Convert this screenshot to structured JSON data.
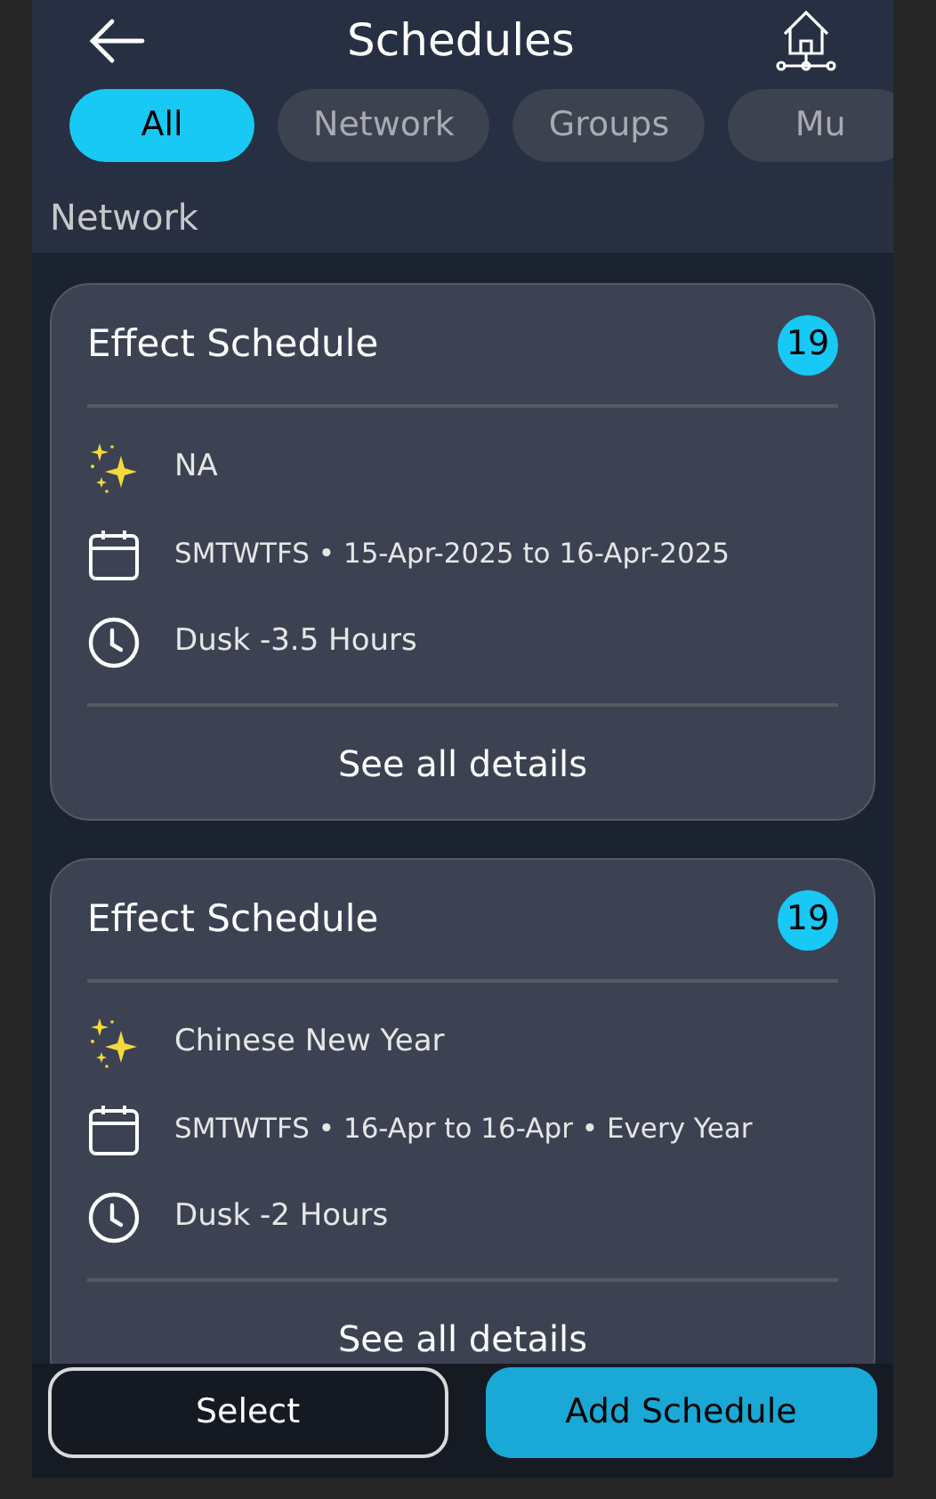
{
  "header": {
    "title": "Schedules"
  },
  "tabs": [
    {
      "label": "All",
      "selected": true
    },
    {
      "label": "Network",
      "selected": false
    },
    {
      "label": "Groups",
      "selected": false
    },
    {
      "label": "Mu",
      "selected": false
    }
  ],
  "section": {
    "title": "Network"
  },
  "cards": [
    {
      "title": "Effect Schedule",
      "count": "19",
      "effect": "NA",
      "dates": "SMTWTFS • 15-Apr-2025 to 16-Apr-2025",
      "time": "Dusk -3.5 Hours",
      "link": "See all details"
    },
    {
      "title": "Effect Schedule",
      "count": "19",
      "effect": "Chinese New Year",
      "dates": "SMTWTFS • 16-Apr to 16-Apr • Every Year",
      "time": "Dusk -2 Hours",
      "link": "See all details"
    }
  ],
  "footer": {
    "buttons": [
      {
        "label": "Select",
        "kind": "outline"
      },
      {
        "label": "Add Schedule",
        "kind": "primary"
      }
    ]
  }
}
